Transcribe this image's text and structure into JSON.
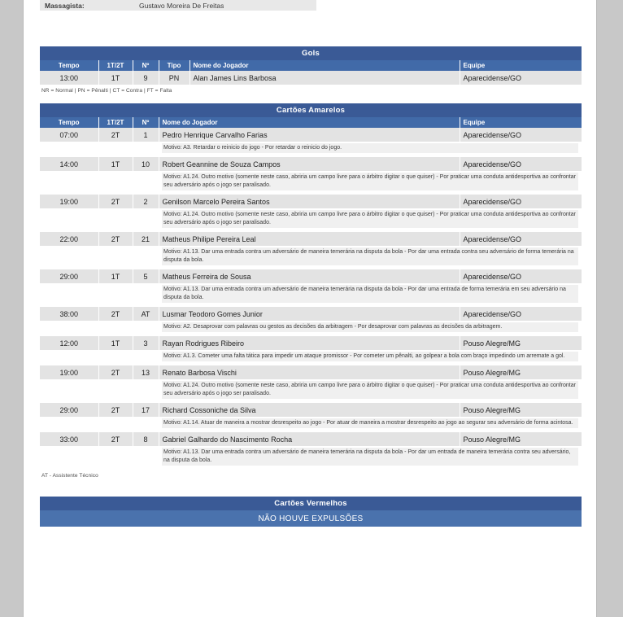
{
  "staff": {
    "label": "Massagista:",
    "value": "Gustavo Moreira De Freitas"
  },
  "goals": {
    "title": "Gols",
    "columns": {
      "tempo": "Tempo",
      "periodo": "1T/2T",
      "numero": "Nº",
      "tipo": "Tipo",
      "jogador": "Nome do Jogador",
      "equipe": "Equipe"
    },
    "rows": [
      {
        "tempo": "13:00",
        "periodo": "1T",
        "numero": "9",
        "tipo": "PN",
        "jogador": "Alan James Lins Barbosa",
        "equipe": "Aparecidense/GO"
      }
    ],
    "legend": "NR = Normal | PN = Pênalti | CT = Contra | FT = Falta"
  },
  "yellow_cards": {
    "title": "Cartões Amarelos",
    "columns": {
      "tempo": "Tempo",
      "periodo": "1T/2T",
      "numero": "Nº",
      "jogador": "Nome do Jogador",
      "equipe": "Equipe"
    },
    "rows": [
      {
        "tempo": "07:00",
        "periodo": "2T",
        "numero": "1",
        "jogador": "Pedro Henrique Carvalho Farias",
        "equipe": "Aparecidense/GO",
        "motivo": "Motivo: A3.  Retardar o reinicio do jogo  - Por retardar o reinicio do jogo."
      },
      {
        "tempo": "14:00",
        "periodo": "1T",
        "numero": "10",
        "jogador": "Robert Geannine de Souza Campos",
        "equipe": "Aparecidense/GO",
        "motivo": "Motivo: A1.24.  Outro motivo (somente neste caso, abriria um campo livre para o árbitro digitar o que quiser) - Por praticar uma conduta antidesportiva ao confrontar seu adversário após o jogo ser paralisado."
      },
      {
        "tempo": "19:00",
        "periodo": "2T",
        "numero": "2",
        "jogador": "Genilson Marcelo Pereira Santos",
        "equipe": "Aparecidense/GO",
        "motivo": "Motivo: A1.24.  Outro motivo (somente neste caso, abriria um campo livre para o árbitro digitar o que quiser) - Por praticar uma conduta antidesportiva ao confrontar seu adversário após o jogo ser paralisado."
      },
      {
        "tempo": "22:00",
        "periodo": "2T",
        "numero": "21",
        "jogador": "Matheus Philipe Pereira Leal",
        "equipe": "Aparecidense/GO",
        "motivo": "Motivo: A1.13.  Dar uma entrada contra um adversário de maneira temerária na disputa da bola - Por dar uma entrada contra seu adversário de forma temerária na disputa da bola."
      },
      {
        "tempo": "29:00",
        "periodo": "1T",
        "numero": "5",
        "jogador": "Matheus Ferreira de Sousa",
        "equipe": "Aparecidense/GO",
        "motivo": "Motivo: A1.13.  Dar uma entrada contra um adversário de maneira temerária na disputa da bola - Por dar uma entrada de forma temerária em seu adversário na disputa da bola."
      },
      {
        "tempo": "38:00",
        "periodo": "2T",
        "numero": "AT",
        "jogador": "Lusmar Teodoro Gomes Junior",
        "equipe": "Aparecidense/GO",
        "motivo": "Motivo: A2.  Desaprovar com palavras ou gestos as decisões da arbitragem  - Por desaprovar com palavras  as decisões da arbitragem."
      },
      {
        "tempo": "12:00",
        "periodo": "1T",
        "numero": "3",
        "jogador": "Rayan Rodrigues Ribeiro",
        "equipe": "Pouso Alegre/MG",
        "motivo": "Motivo: A1.3.  Cometer uma falta tática para impedir um ataque promissor - Por cometer um pênalti, ao golpear a bola com braço impedindo um arremate a gol."
      },
      {
        "tempo": "19:00",
        "periodo": "2T",
        "numero": "13",
        "jogador": "Renato Barbosa Vischi",
        "equipe": "Pouso Alegre/MG",
        "motivo": "Motivo: A1.24.  Outro motivo (somente neste caso, abriria um campo livre para o árbitro digitar o que quiser) - Por praticar uma conduta antidesportiva ao confrontar seu adversário após o jogo ser paralisado."
      },
      {
        "tempo": "29:00",
        "periodo": "2T",
        "numero": "17",
        "jogador": "Richard Cossoniche da Silva",
        "equipe": "Pouso Alegre/MG",
        "motivo": "Motivo: A1.14.  Atuar de maneira a mostrar desrespeito ao jogo - Por atuar de maneira a mostrar desrespeito ao jogo ao segurar seu adversário de forma acintosa."
      },
      {
        "tempo": "33:00",
        "periodo": "2T",
        "numero": "8",
        "jogador": "Gabriel Galhardo do Nascimento Rocha",
        "equipe": "Pouso Alegre/MG",
        "motivo": "Motivo: A1.13.  Dar uma entrada contra um adversário de maneira temerária na disputa da bola - Por dar um entrada de maneira temerária contra seu adversário, na disputa da bola."
      }
    ],
    "legend": "AT - Assistente Técnico"
  },
  "red_cards": {
    "title": "Cartões Vermelhos",
    "empty_message": "NÃO HOUVE EXPULSÕES"
  },
  "colors": {
    "title_bar": "#3a5a96",
    "column_header": "#416aa8",
    "row_bg": "#e3e3e3",
    "empty_bar": "#4a72ad"
  }
}
